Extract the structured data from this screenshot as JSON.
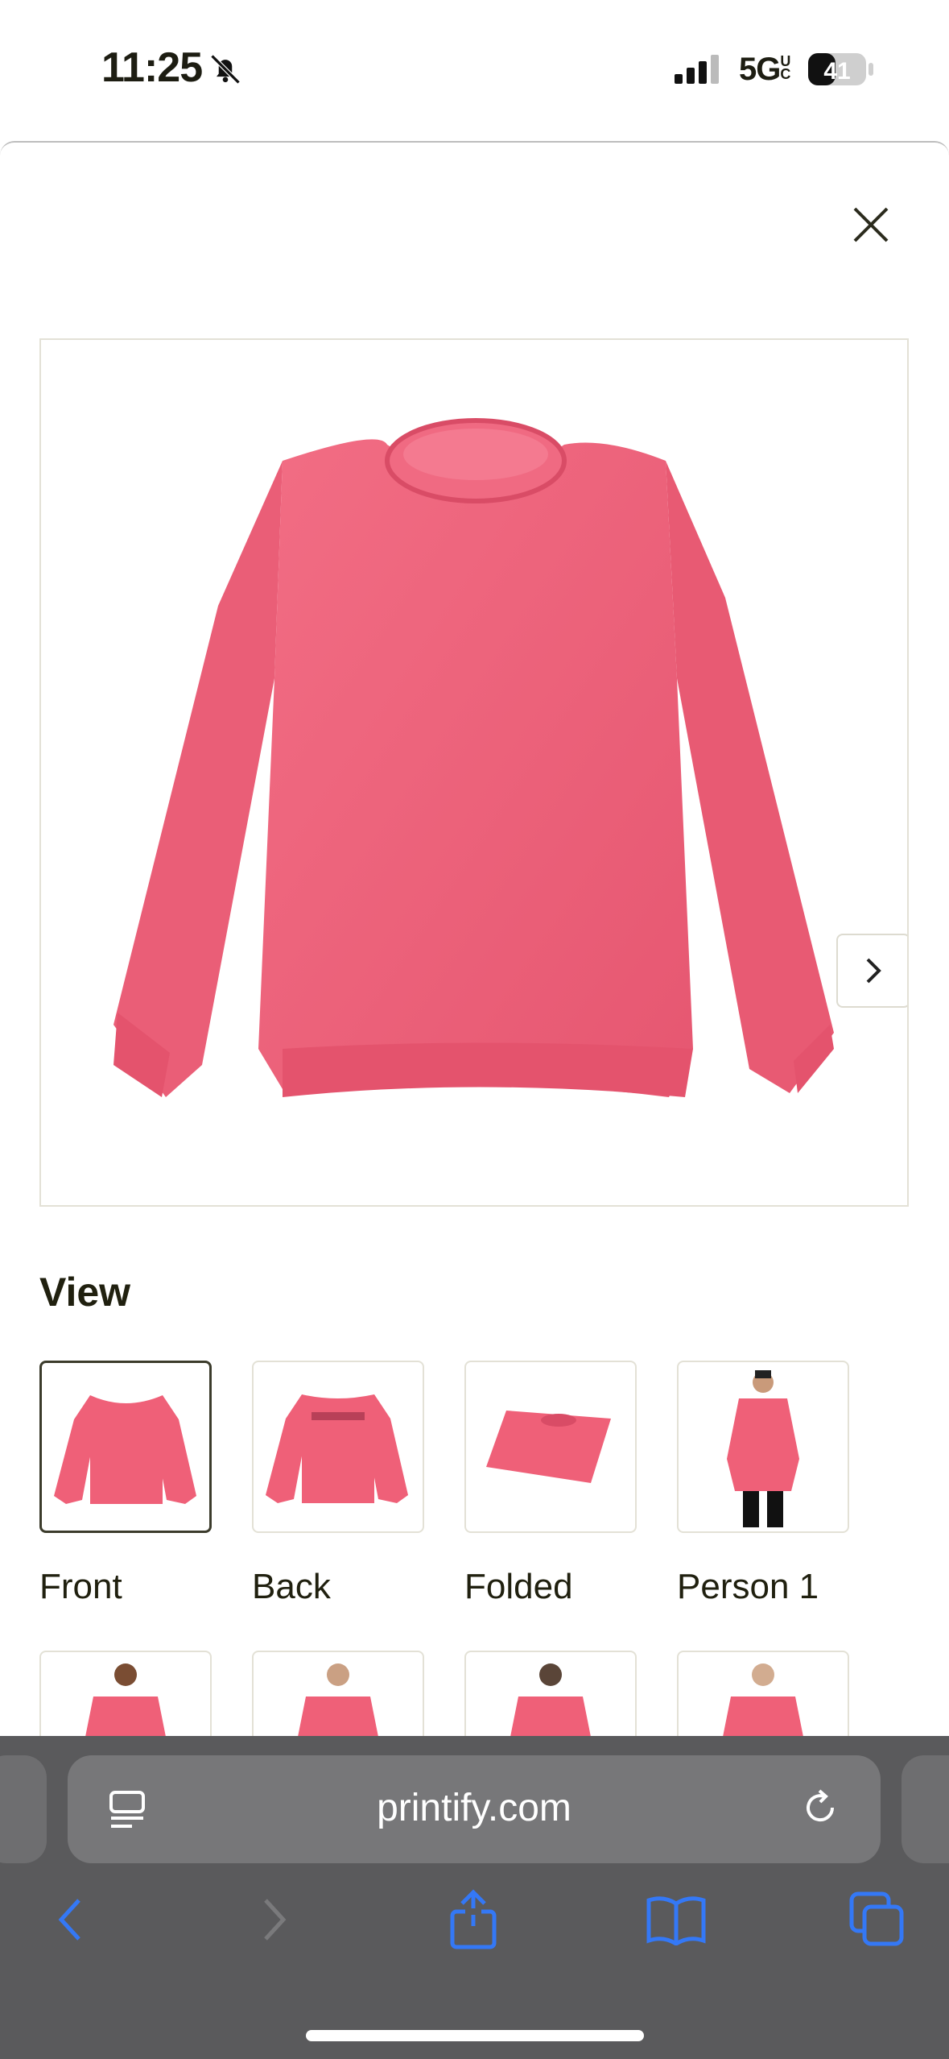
{
  "status_bar": {
    "time": "11:25",
    "network": "5G",
    "network_sub": "UC",
    "battery": "41"
  },
  "modal": {
    "hero_alt": "Pink crewneck sweatshirt",
    "view_title": "View",
    "thumbnails": [
      {
        "label": "Front",
        "selected": true
      },
      {
        "label": "Back"
      },
      {
        "label": "Folded"
      },
      {
        "label": "Person 1"
      }
    ],
    "product_color": "#ef6078"
  },
  "browser": {
    "url": "printify.com"
  },
  "colors": {
    "accent": "#3478f6",
    "safari_bg": "#5a5a5c"
  }
}
